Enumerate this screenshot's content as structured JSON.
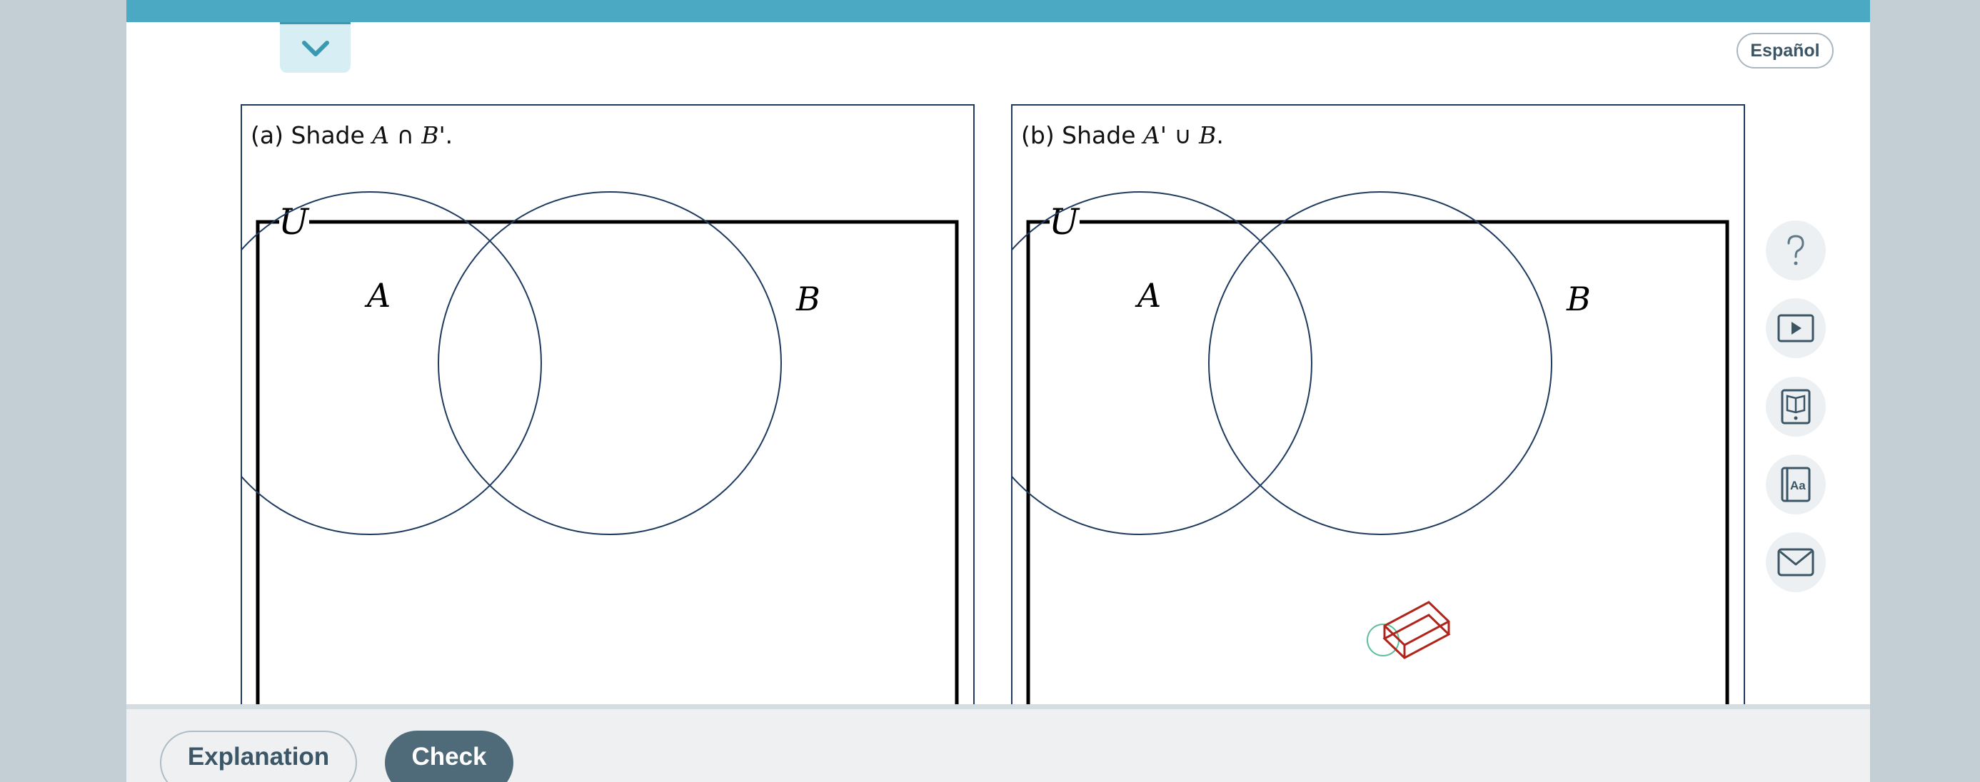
{
  "header": {
    "language_button": "Español",
    "collapse_icon": "chevron-down-icon",
    "accent_color": "#4ba9c3"
  },
  "panels": [
    {
      "prefix": "(a) Shade",
      "set1": "A",
      "mark1": "",
      "operator": "∩",
      "set2": "B",
      "mark2": "'",
      "suffix": ".",
      "universe_label": "U",
      "circle_a_label": "A",
      "circle_b_label": "B"
    },
    {
      "prefix": "(b) Shade",
      "set1": "A",
      "mark1": "'",
      "operator": "∪",
      "set2": "B",
      "mark2": "",
      "suffix": ".",
      "universe_label": "U",
      "circle_a_label": "A",
      "circle_b_label": "B"
    }
  ],
  "side_tools": [
    {
      "icon": "help-icon"
    },
    {
      "icon": "video-play-icon"
    },
    {
      "icon": "ebook-icon"
    },
    {
      "icon": "glossary-icon"
    },
    {
      "icon": "message-icon"
    }
  ],
  "footer": {
    "explanation_label": "Explanation",
    "check_label": "Check"
  },
  "cursor_icon": "eraser-icon"
}
